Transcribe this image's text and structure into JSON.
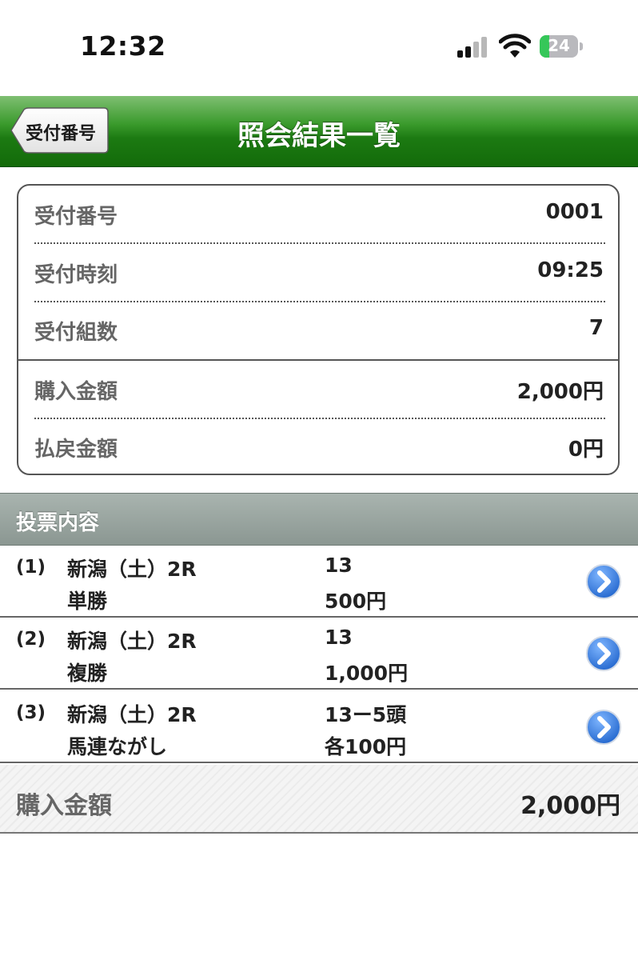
{
  "status_bar": {
    "time": "12:32",
    "battery": "24"
  },
  "nav": {
    "back_label": "受付番号",
    "title": "照会結果一覧"
  },
  "summary": {
    "rows": [
      {
        "label": "受付番号",
        "value": "0001"
      },
      {
        "label": "受付時刻",
        "value": "09:25"
      },
      {
        "label": "受付組数",
        "value": "7"
      },
      {
        "label": "購入金額",
        "value": "2,000円"
      },
      {
        "label": "払戻金額",
        "value": "0円"
      }
    ]
  },
  "section": {
    "title": "投票内容"
  },
  "bets": [
    {
      "num": "(1)",
      "race": "新潟（土）2R",
      "kind": "単勝",
      "horses": "13",
      "amount": "500円"
    },
    {
      "num": "(2)",
      "race": "新潟（土）2R",
      "kind": "複勝",
      "horses": "13",
      "amount": "1,000円"
    },
    {
      "num": "(3)",
      "race": "新潟（土）2R",
      "kind": "馬連ながし",
      "horses": "13ー5頭",
      "amount": "各100円"
    }
  ],
  "total": {
    "label": "購入金額",
    "value": "2,000円"
  },
  "colors": {
    "nav_green": "#1c7a12",
    "battery_green": "#35c759",
    "arrow_blue": "#1f6fd6"
  },
  "icons": {
    "back": "back-arrow-button",
    "row": "chevron-right-circle-icon"
  }
}
